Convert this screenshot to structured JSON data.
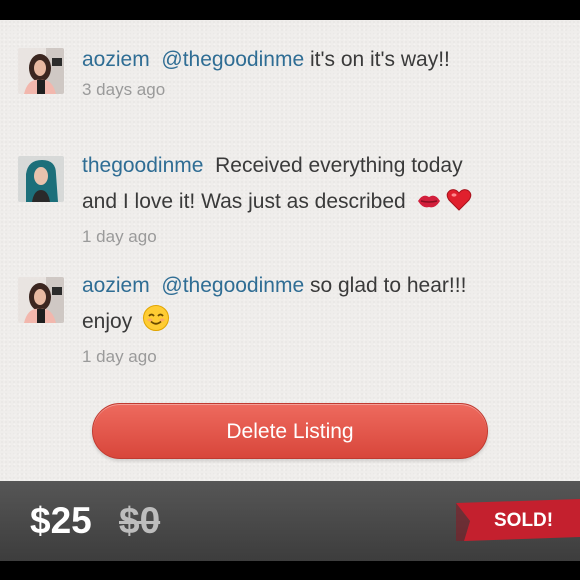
{
  "comments": [
    {
      "username": "aoziem",
      "mention": "@thegoodinme",
      "text": "it's on it's way!!",
      "time": "3 days ago",
      "avatar_icon": "user-avatar-aoziem"
    },
    {
      "username": "thegoodinme",
      "text_line1": "Received everything today",
      "text_line2": "and I love it! Was just as described",
      "emoji": [
        "kiss-mark-icon",
        "red-heart-icon"
      ],
      "time": "1 day ago",
      "avatar_icon": "user-avatar-thegoodinme"
    },
    {
      "username": "aoziem",
      "mention": "@thegoodinme",
      "text_line1": "so glad to hear!!!",
      "text_line2": "enjoy",
      "emoji": [
        "smiling-face-icon"
      ],
      "time": "1 day ago",
      "avatar_icon": "user-avatar-aoziem"
    }
  ],
  "delete_button": {
    "label": "Delete Listing",
    "color": "#e0554a"
  },
  "price_bar": {
    "price": "$25",
    "original_price": "$0",
    "sold_label": "SOLD!",
    "sold_color": "#c4202e"
  },
  "colors": {
    "link": "#2f6d94",
    "text": "#3a3a3a",
    "timestamp": "#9a9a9a",
    "background": "#efedeb"
  }
}
